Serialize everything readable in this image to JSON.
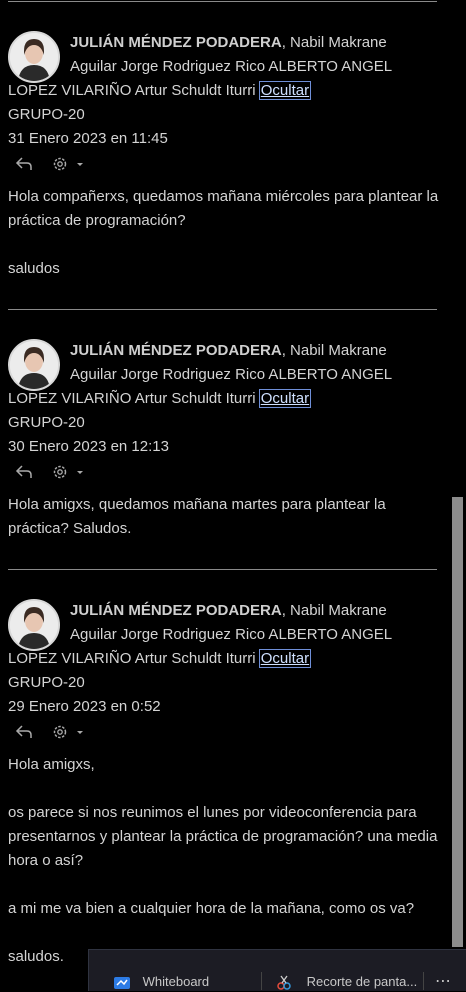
{
  "messages": [
    {
      "author": "JULIÁN MÉNDEZ PODADERA",
      "recipients_line1": ", Nabil Makrane",
      "recipients_line2": "Aguilar Jorge Rodriguez Rico ALBERTO ANGEL",
      "recipients_line3": "LOPEZ VILARIÑO Artur Schuldt Iturri",
      "hide_link": "Ocultar",
      "group": "GRUPO-20",
      "date": "31 Enero 2023 en 11:45",
      "body": [
        "Hola compañerxs, quedamos mañana miércoles para plantear la práctica de programación?",
        "",
        "saludos"
      ]
    },
    {
      "author": "JULIÁN MÉNDEZ PODADERA",
      "recipients_line1": ", Nabil Makrane",
      "recipients_line2": "Aguilar Jorge Rodriguez Rico ALBERTO ANGEL",
      "recipients_line3": "LOPEZ VILARIÑO Artur Schuldt Iturri",
      "hide_link": "Ocultar",
      "group": "GRUPO-20",
      "date": "30 Enero 2023 en 12:13",
      "body": [
        "Hola amigxs, quedamos mañana martes para plantear la práctica? Saludos."
      ]
    },
    {
      "author": "JULIÁN MÉNDEZ PODADERA",
      "recipients_line1": ", Nabil Makrane",
      "recipients_line2": "Aguilar Jorge Rodriguez Rico ALBERTO ANGEL",
      "recipients_line3": "LOPEZ VILARIÑO Artur Schuldt Iturri",
      "hide_link": "Ocultar",
      "group": "GRUPO-20",
      "date": "29 Enero 2023 en 0:52",
      "body": [
        "Hola amigxs,",
        "",
        "os parece si nos reunimos el lunes por videoconferencia para presentarnos y plantear la práctica de programación? una media hora o así?",
        "",
        "a mi me va bien a cualquier hora de la mañana, como os va?",
        "",
        "saludos."
      ]
    }
  ],
  "taskbar": {
    "items": [
      {
        "label": "Whiteboard",
        "icon": "whiteboard-icon"
      },
      {
        "label": "Recorte de panta...",
        "icon": "snipping-tool-icon"
      }
    ],
    "more": "⋯"
  },
  "colors": {
    "background": "#000000",
    "text": "#d4d4d4",
    "link_outline": "#6f8fd8",
    "scrollbar": "#8c8c8c"
  }
}
